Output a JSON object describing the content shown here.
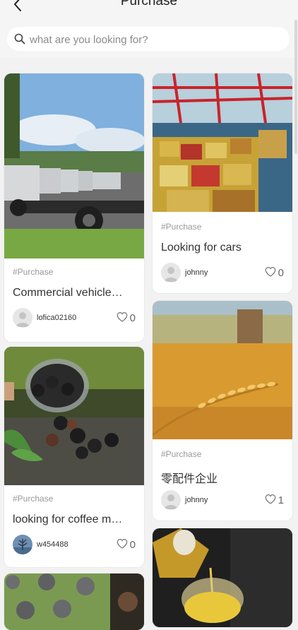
{
  "header": {
    "title": "Purchase"
  },
  "search": {
    "placeholder": "what are you looking for?"
  },
  "colors": {
    "bg": "#f2f2f2",
    "card": "#ffffff",
    "tag": "#999999"
  },
  "posts": [
    {
      "tag": "#Purchase",
      "title": "Commercial vehicle…",
      "user": "lofica02160",
      "likes": "0",
      "image": "trucks-photo"
    },
    {
      "tag": "#Purchase",
      "title": "Looking for cars",
      "user": "johnny",
      "likes": "0",
      "image": "shipping-port-photo"
    },
    {
      "tag": "#Purchase",
      "title": "looking for coffee m…",
      "user": "w454488",
      "likes": "0",
      "image": "coffee-beans-photo"
    },
    {
      "tag": "#Purchase",
      "title": "零配件企业",
      "user": "johnny",
      "likes": "1",
      "image": "wheat-field-photo"
    },
    {
      "image": "lotus-seeds-photo"
    },
    {
      "image": "cooking-oil-photo"
    }
  ]
}
